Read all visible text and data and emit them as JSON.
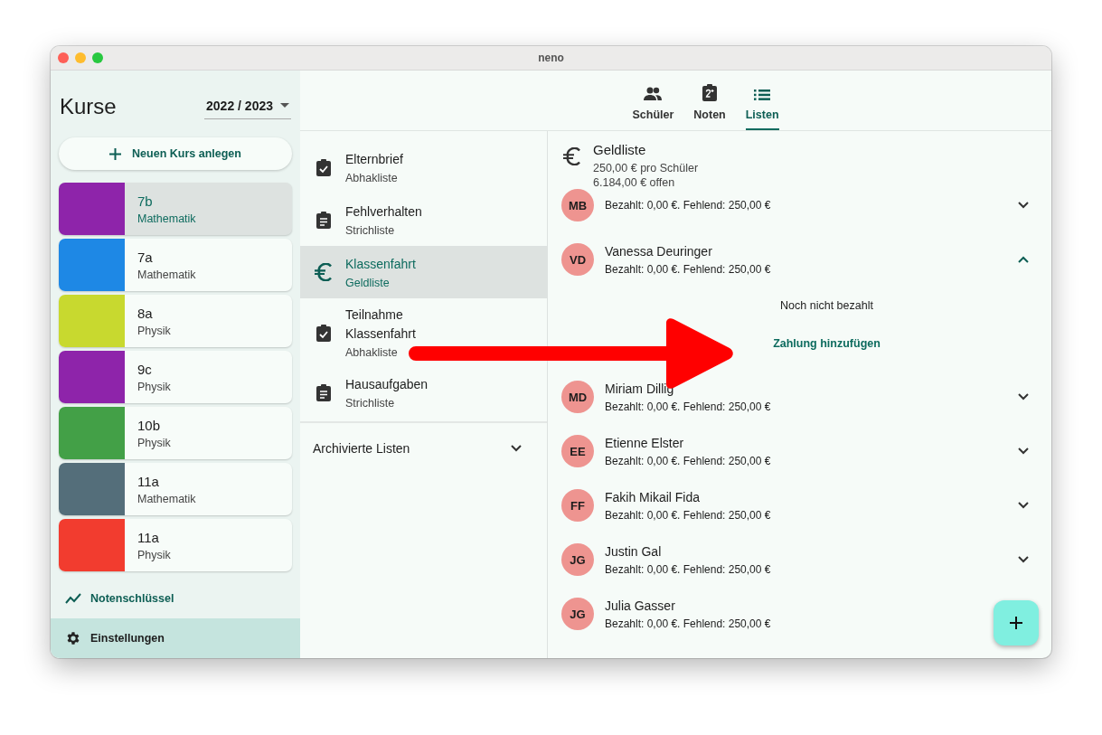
{
  "window": {
    "title": "neno"
  },
  "sidebar": {
    "title": "Kurse",
    "year": "2022 / 2023",
    "new_course_button": "Neuen Kurs anlegen",
    "courses": [
      {
        "name": "7b",
        "subject": "Mathematik",
        "color": "#8e24aa",
        "selected": true
      },
      {
        "name": "7a",
        "subject": "Mathematik",
        "color": "#1e88e5",
        "selected": false
      },
      {
        "name": "8a",
        "subject": "Physik",
        "color": "#c8d92f",
        "selected": false
      },
      {
        "name": "9c",
        "subject": "Physik",
        "color": "#8e24aa",
        "selected": false
      },
      {
        "name": "10b",
        "subject": "Physik",
        "color": "#43a047",
        "selected": false
      },
      {
        "name": "11a",
        "subject": "Mathematik",
        "color": "#546e7a",
        "selected": false
      },
      {
        "name": "11a",
        "subject": "Physik",
        "color": "#f23c2f",
        "selected": false
      }
    ],
    "grade_key": "Notenschlüssel",
    "settings": "Einstellungen"
  },
  "tabs": [
    {
      "label": "Schüler",
      "kind": "people",
      "selected": false
    },
    {
      "label": "Noten",
      "kind": "grades",
      "selected": false
    },
    {
      "label": "Listen",
      "kind": "list",
      "selected": true
    }
  ],
  "lists": {
    "items": [
      {
        "title": "Elternbrief",
        "subtitle": "Abhakliste",
        "kind": "checklist",
        "selected": false
      },
      {
        "title": "Fehlverhalten",
        "subtitle": "Strichliste",
        "kind": "tally",
        "selected": false
      },
      {
        "title": "Klassenfahrt",
        "subtitle": "Geldliste",
        "kind": "money",
        "selected": true
      },
      {
        "title": "Teilnahme Klassenfahrt",
        "subtitle": "Abhakliste",
        "kind": "checklist",
        "selected": false
      },
      {
        "title": "Hausaufgaben",
        "subtitle": "Strichliste",
        "kind": "tally",
        "selected": false
      }
    ],
    "archived": {
      "label": "Archivierte Listen",
      "expanded": false
    }
  },
  "detail": {
    "title": "Geldliste",
    "per_student": "250,00 € pro Schüler",
    "open": "6.184,00 € offen",
    "students": [
      {
        "initials": "MB",
        "status": "Bezahlt: 0,00 €. Fehlend: 250,00 €",
        "expanded": false
      },
      {
        "initials": "VD",
        "name": "Vanessa Deuringer",
        "status": "Bezahlt: 0,00 €. Fehlend: 250,00 €",
        "expanded": true,
        "payment_state": "Noch nicht bezahlt",
        "action": "Zahlung hinzufügen"
      },
      {
        "initials": "MD",
        "name": "Miriam Dillig",
        "status": "Bezahlt: 0,00 €. Fehlend: 250,00 €",
        "expanded": false
      },
      {
        "initials": "EE",
        "name": "Etienne Elster",
        "status": "Bezahlt: 0,00 €. Fehlend: 250,00 €",
        "expanded": false
      },
      {
        "initials": "FF",
        "name": "Fakih Mikail Fida",
        "status": "Bezahlt: 0,00 €. Fehlend: 250,00 €",
        "expanded": false
      },
      {
        "initials": "JG",
        "name": "Justin Gal",
        "status": "Bezahlt: 0,00 €. Fehlend: 250,00 €",
        "expanded": false
      },
      {
        "initials": "JG",
        "name": "Julia Gasser",
        "status": "Bezahlt: 0,00 €. Fehlend: 250,00 €"
      }
    ]
  }
}
